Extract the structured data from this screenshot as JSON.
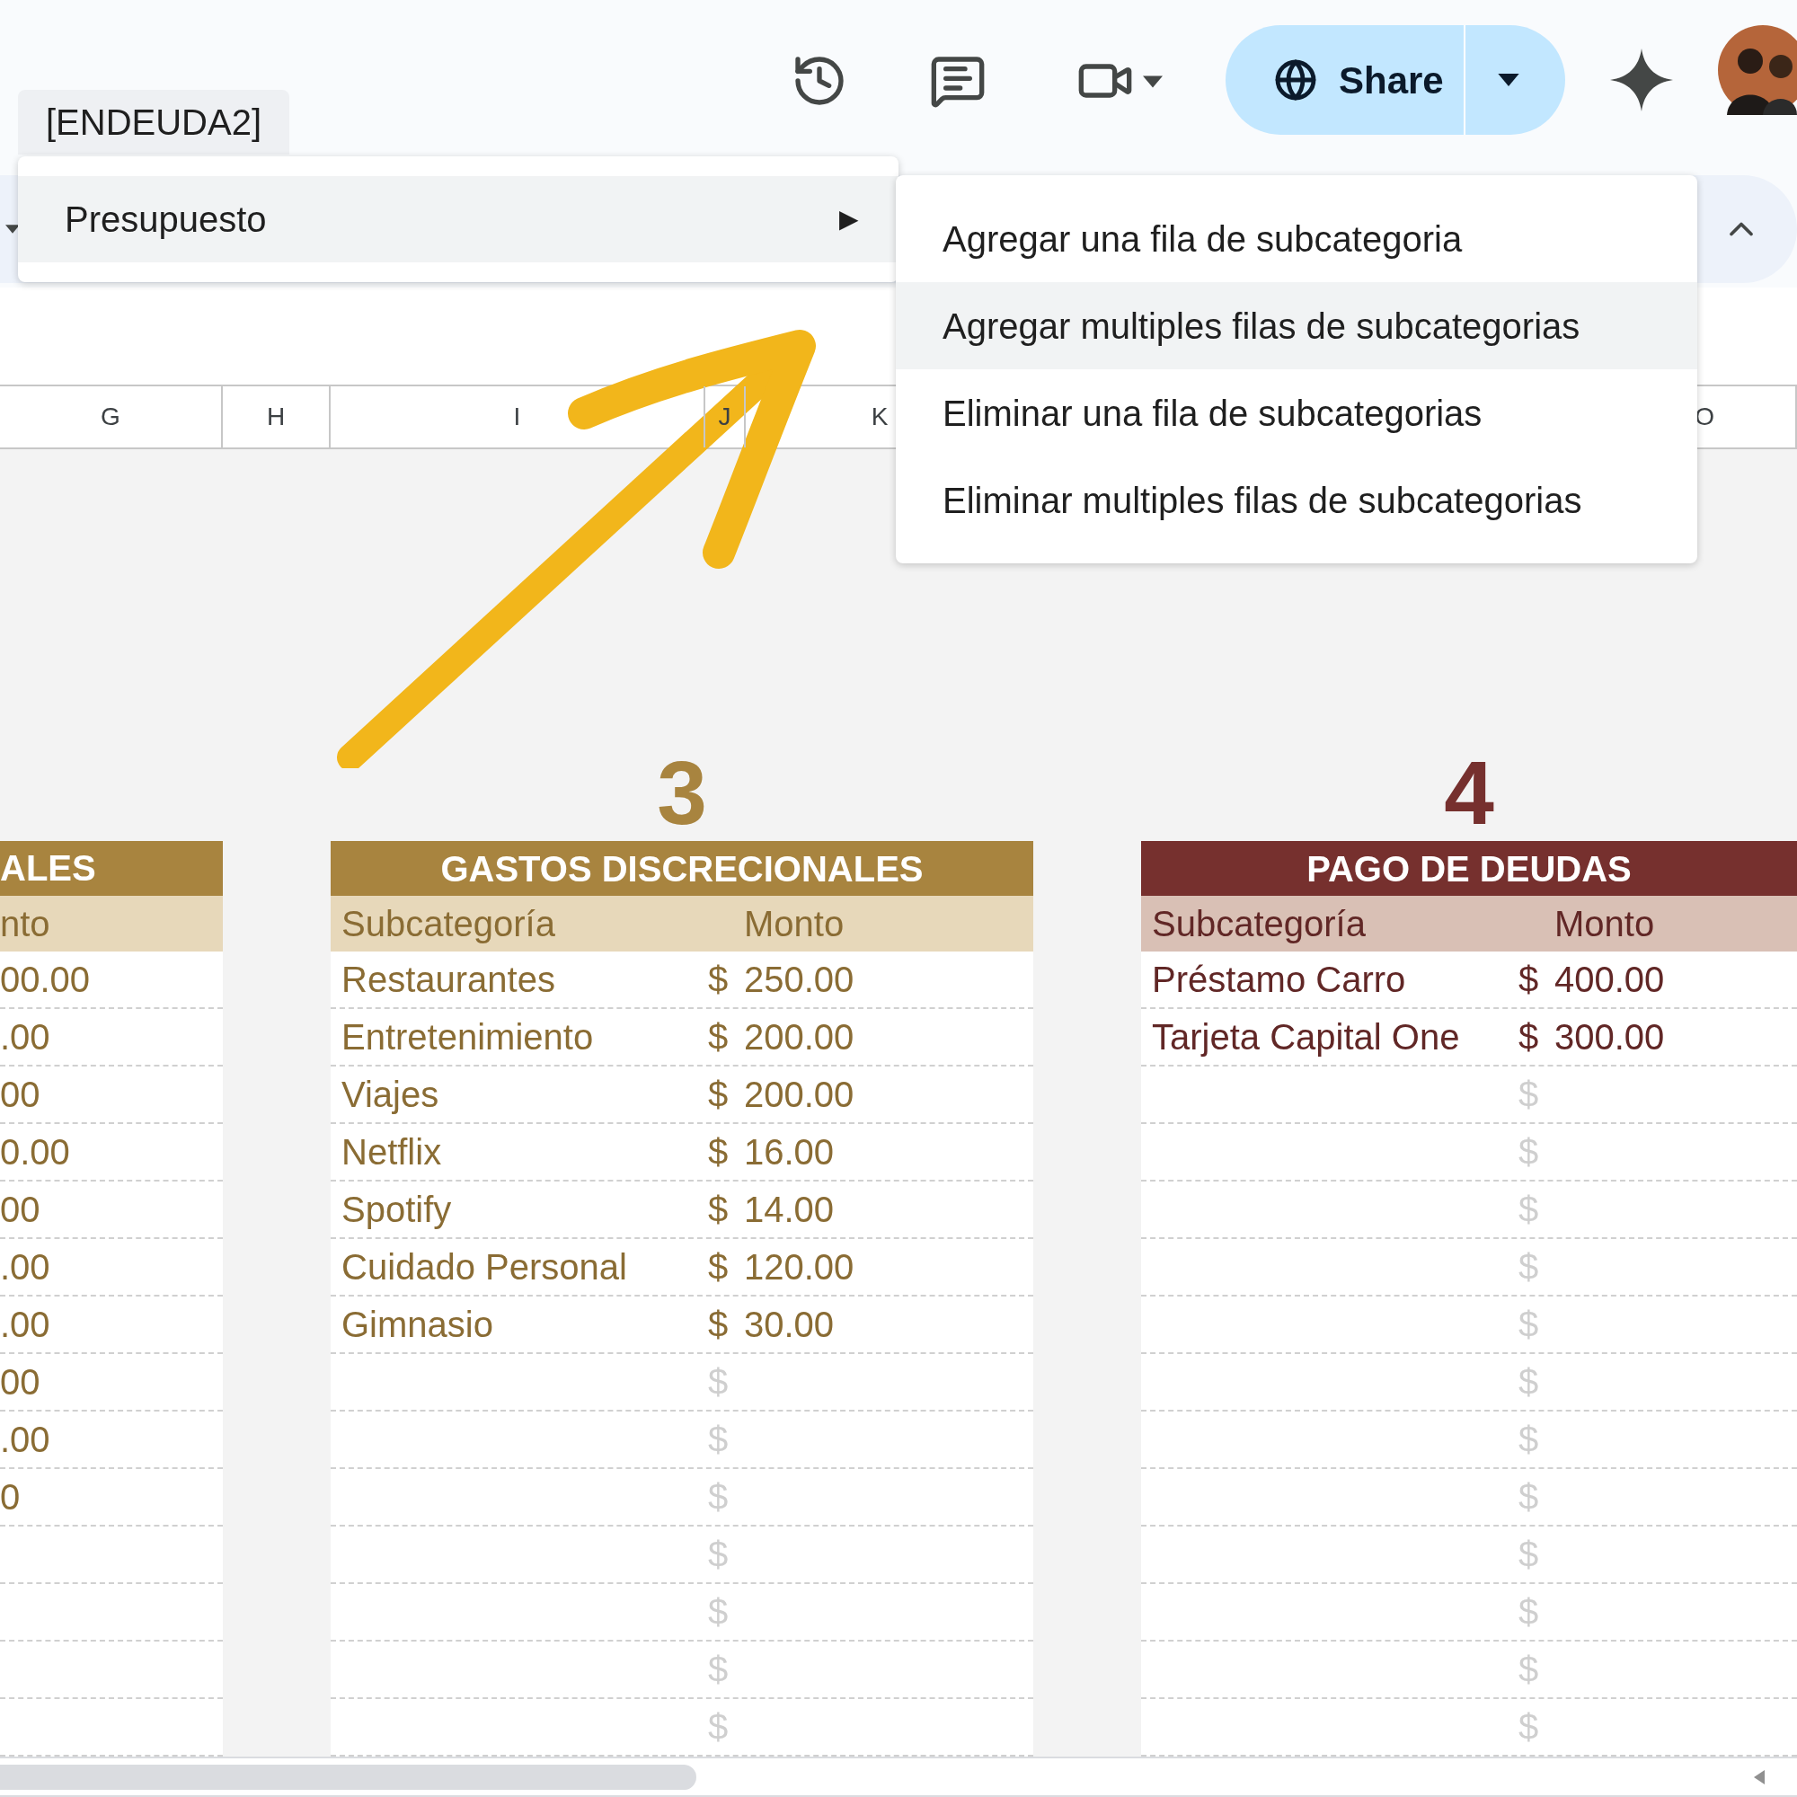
{
  "top_bar": {
    "share_label": "Share"
  },
  "sheet_menu_label": "[ENDEUDA2]",
  "menu": {
    "items": [
      {
        "label": "Presupuesto",
        "marker": "▶",
        "selected": true
      }
    ]
  },
  "submenu": {
    "items": [
      {
        "label": "Agregar una fila de subcategoria",
        "selected": false
      },
      {
        "label": "Agregar multiples filas de subcategorias",
        "selected": true
      },
      {
        "label": "Eliminar una fila de subcategorias",
        "selected": false
      },
      {
        "label": "Eliminar multiples filas de subcategorias",
        "selected": false
      }
    ]
  },
  "columns": [
    "G",
    "H",
    "I",
    "J",
    "K",
    "O"
  ],
  "left_table": {
    "color": "#a8843f",
    "title": "ALES",
    "header": "nto",
    "values": [
      "00.00",
      ".00",
      "00",
      "0.00",
      "00",
      ".00",
      ".00",
      "00",
      ".00",
      "0"
    ]
  },
  "tables": [
    {
      "number": "3",
      "title": "GASTOS DISCRECIONALES",
      "color": "#a8843f",
      "headers": [
        "Subcategoría",
        "Monto"
      ],
      "rows": [
        {
          "name": "Restaurantes",
          "currency": "$",
          "amount": "250.00"
        },
        {
          "name": "Entretenimiento",
          "currency": "$",
          "amount": "200.00"
        },
        {
          "name": "Viajes",
          "currency": "$",
          "amount": "200.00"
        },
        {
          "name": "Netflix",
          "currency": "$",
          "amount": "16.00"
        },
        {
          "name": "Spotify",
          "currency": "$",
          "amount": "14.00"
        },
        {
          "name": "Cuidado Personal",
          "currency": "$",
          "amount": "120.00"
        },
        {
          "name": "Gimnasio",
          "currency": "$",
          "amount": "30.00"
        },
        {
          "currency": "$"
        },
        {
          "currency": "$"
        },
        {
          "currency": "$"
        },
        {
          "currency": "$"
        },
        {
          "currency": "$"
        },
        {
          "currency": "$"
        },
        {
          "currency": "$"
        }
      ]
    },
    {
      "number": "4",
      "title": "PAGO DE DEUDAS",
      "color": "#76302e",
      "headers": [
        "Subcategoría",
        "Monto"
      ],
      "rows": [
        {
          "name": "Préstamo Carro",
          "currency": "$",
          "amount": "400.00"
        },
        {
          "name": "Tarjeta Capital One",
          "currency": "$",
          "amount": "300.00"
        },
        {
          "currency": "$"
        },
        {
          "currency": "$"
        },
        {
          "currency": "$"
        },
        {
          "currency": "$"
        },
        {
          "currency": "$"
        },
        {
          "currency": "$"
        },
        {
          "currency": "$"
        },
        {
          "currency": "$"
        },
        {
          "currency": "$"
        },
        {
          "currency": "$"
        },
        {
          "currency": "$"
        },
        {
          "currency": "$"
        }
      ]
    }
  ]
}
